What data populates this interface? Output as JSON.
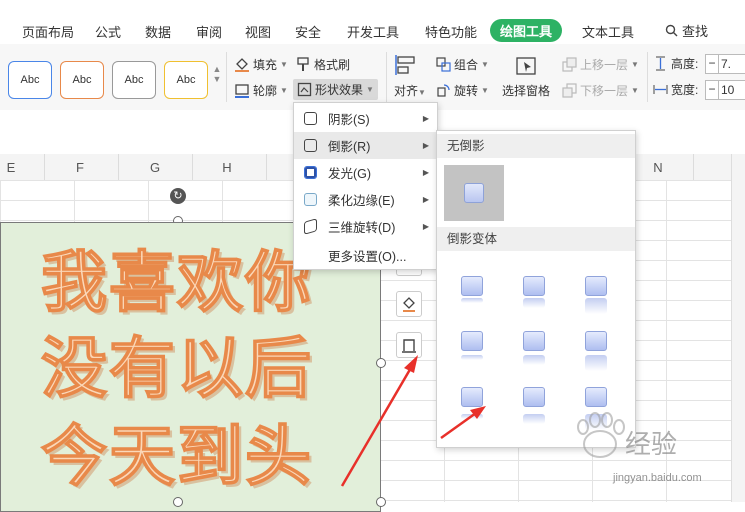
{
  "menubar": {
    "tabs": [
      "页面布局",
      "公式",
      "数据",
      "审阅",
      "视图",
      "安全",
      "开发工具",
      "特色功能",
      "绘图工具",
      "文本工具"
    ],
    "active_tab": "绘图工具",
    "search_label": "查找",
    "active_color": "#2db264"
  },
  "ribbon": {
    "styles": [
      {
        "label": "Abc",
        "color": "#4a86e8"
      },
      {
        "label": "Abc",
        "color": "#e8894a"
      },
      {
        "label": "Abc",
        "color": "#999999"
      },
      {
        "label": "Abc",
        "color": "#f0c030"
      }
    ],
    "fill_label": "填充",
    "outline_label": "轮廓",
    "format_brush_label": "格式刷",
    "shape_effect_label": "形状效果",
    "align_label": "对齐",
    "group_label": "组合",
    "rotate_label": "旋转",
    "select_pane_label": "选择窗格",
    "move_up_label": "上移一层",
    "move_down_label": "下移一层",
    "height_label": "高度:",
    "width_label": "宽度:",
    "height_value": "7.",
    "width_value": "10"
  },
  "sheet": {
    "columns_left": [
      "E",
      "F",
      "G",
      "H"
    ],
    "column_right": "N",
    "shape_lines": [
      "我喜欢你",
      "没有以后",
      "今天到头"
    ],
    "shape_fill": "#e2efda",
    "text_color": "#e8894a"
  },
  "effect_menu": {
    "items": [
      {
        "label": "阴影(S)",
        "icon": "shadow-icon",
        "has_sub": true
      },
      {
        "label": "倒影(R)",
        "icon": "reflection-icon",
        "has_sub": true
      },
      {
        "label": "发光(G)",
        "icon": "glow-icon",
        "has_sub": true
      },
      {
        "label": "柔化边缘(E)",
        "icon": "soft-edge-icon",
        "has_sub": true
      },
      {
        "label": "三维旋转(D)",
        "icon": "3d-rotate-icon",
        "has_sub": true
      },
      {
        "label": "更多设置(O)...",
        "icon": "",
        "has_sub": false
      }
    ],
    "highlighted": "倒影(R)"
  },
  "reflection_submenu": {
    "none_header": "无倒影",
    "variants_header": "倒影变体",
    "variant_count": 9
  },
  "watermark": {
    "site": "jingyan.baidu.com",
    "name": "经验"
  },
  "annotation_color": "#e8302a"
}
